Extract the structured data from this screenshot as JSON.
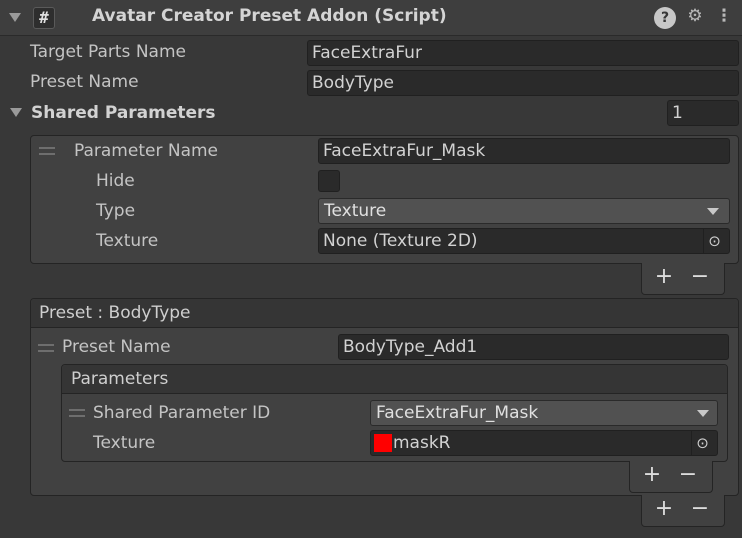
{
  "component": {
    "title": "Avatar Creator Preset Addon (Script)",
    "script_glyph": "#",
    "help_glyph": "?",
    "settings_glyph": "⚙",
    "menu_glyph": "⋮"
  },
  "fields": {
    "target_parts_label": "Target Parts Name",
    "target_parts_value": "FaceExtraFur",
    "preset_name_label": "Preset Name",
    "preset_name_value": "BodyType"
  },
  "shared_parameters": {
    "label": "Shared Parameters",
    "count": "1",
    "element": {
      "parameter_name_label": "Parameter Name",
      "parameter_name_value": "FaceExtraFur_Mask",
      "hide_label": "Hide",
      "hide_checked": false,
      "type_label": "Type",
      "type_value": "Texture",
      "texture_label": "Texture",
      "texture_value": "None (Texture 2D)"
    }
  },
  "preset": {
    "header": "Preset : BodyType",
    "preset_name_label": "Preset Name",
    "preset_name_value": "BodyType_Add1",
    "parameters": {
      "header": "Parameters",
      "shared_param_id_label": "Shared Parameter ID",
      "shared_param_id_value": "FaceExtraFur_Mask",
      "texture_label": "Texture",
      "texture_value": "maskR",
      "texture_color": "#ff0000"
    }
  },
  "list_controls": {
    "plus": "+",
    "minus": "−"
  }
}
